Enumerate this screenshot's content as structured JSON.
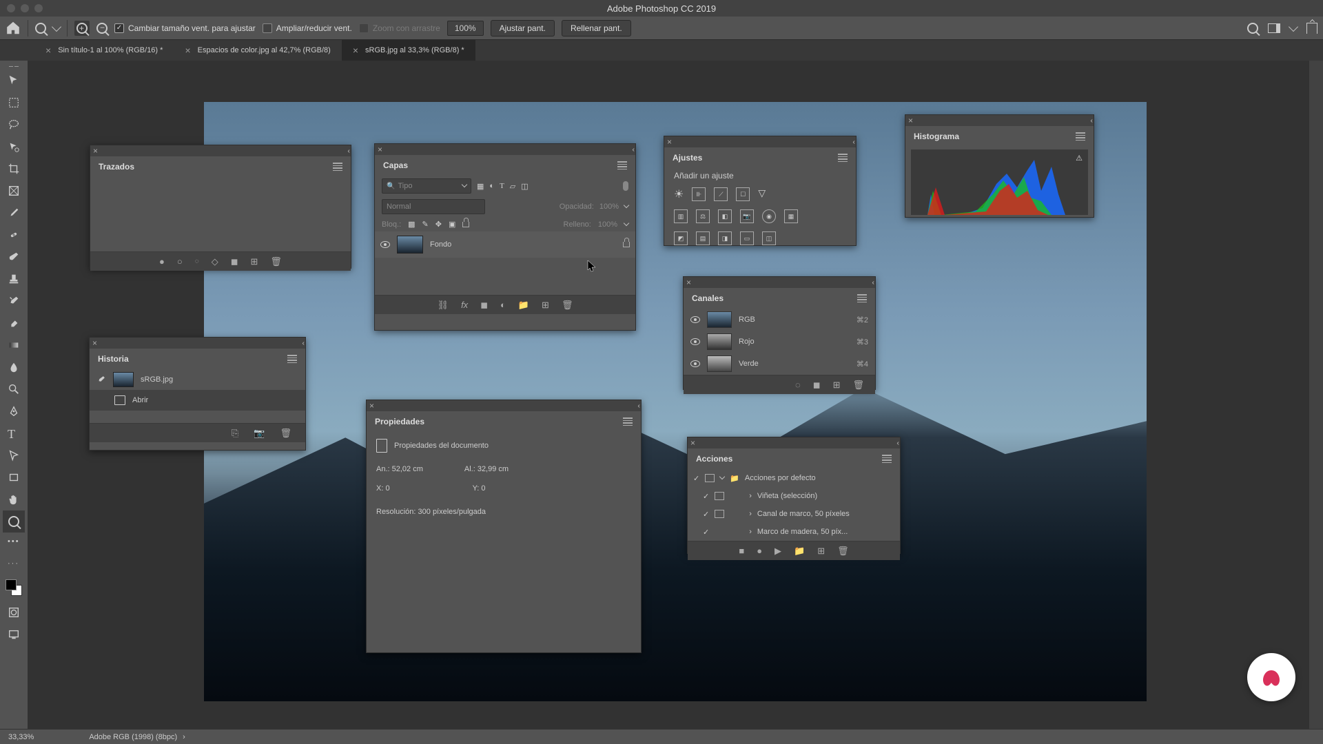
{
  "app_title": "Adobe Photoshop CC 2019",
  "options_bar": {
    "resize_windows": "Cambiar tamaño vent. para ajustar",
    "zoom_resize": "Ampliar/reducir vent.",
    "scrub_zoom": "Zoom con arrastre",
    "zoom_value": "100%",
    "fit_screen": "Ajustar pant.",
    "fill_screen": "Rellenar pant."
  },
  "tabs": [
    {
      "label": "Sin título-1 al 100% (RGB/16) *"
    },
    {
      "label": "Espacios de color.jpg al 42,7% (RGB/8)"
    },
    {
      "label": "sRGB.jpg al 33,3% (RGB/8) *"
    }
  ],
  "panels": {
    "trazados": {
      "title": "Trazados"
    },
    "capas": {
      "title": "Capas",
      "search": "Tipo",
      "blend": "Normal",
      "opacity_label": "Opacidad:",
      "opacity_val": "100%",
      "lock_label": "Bloq.:",
      "fill_label": "Relleno:",
      "fill_val": "100%",
      "layer_name": "Fondo"
    },
    "historia": {
      "title": "Historia",
      "doc": "sRGB.jpg",
      "step1": "Abrir"
    },
    "propiedades": {
      "title": "Propiedades",
      "subtitle": "Propiedades del documento",
      "width": "An.: 52,02 cm",
      "height": "Al.: 32,99 cm",
      "x": "X: 0",
      "y": "Y: 0",
      "resolution": "Resolución: 300 píxeles/pulgada"
    },
    "ajustes": {
      "title": "Ajustes",
      "subtitle": "Añadir un ajuste"
    },
    "canales": {
      "title": "Canales",
      "items": [
        {
          "name": "RGB",
          "key": "⌘2"
        },
        {
          "name": "Rojo",
          "key": "⌘3"
        },
        {
          "name": "Verde",
          "key": "⌘4"
        }
      ]
    },
    "histograma": {
      "title": "Histograma"
    },
    "acciones": {
      "title": "Acciones",
      "items": [
        "Acciones por defecto",
        "Viñeta (selección)",
        "Canal de marco, 50 píxeles",
        "Marco de madera, 50 píx..."
      ]
    }
  },
  "status": {
    "zoom": "33,33%",
    "profile": "Adobe RGB (1998) (8bpc)"
  }
}
